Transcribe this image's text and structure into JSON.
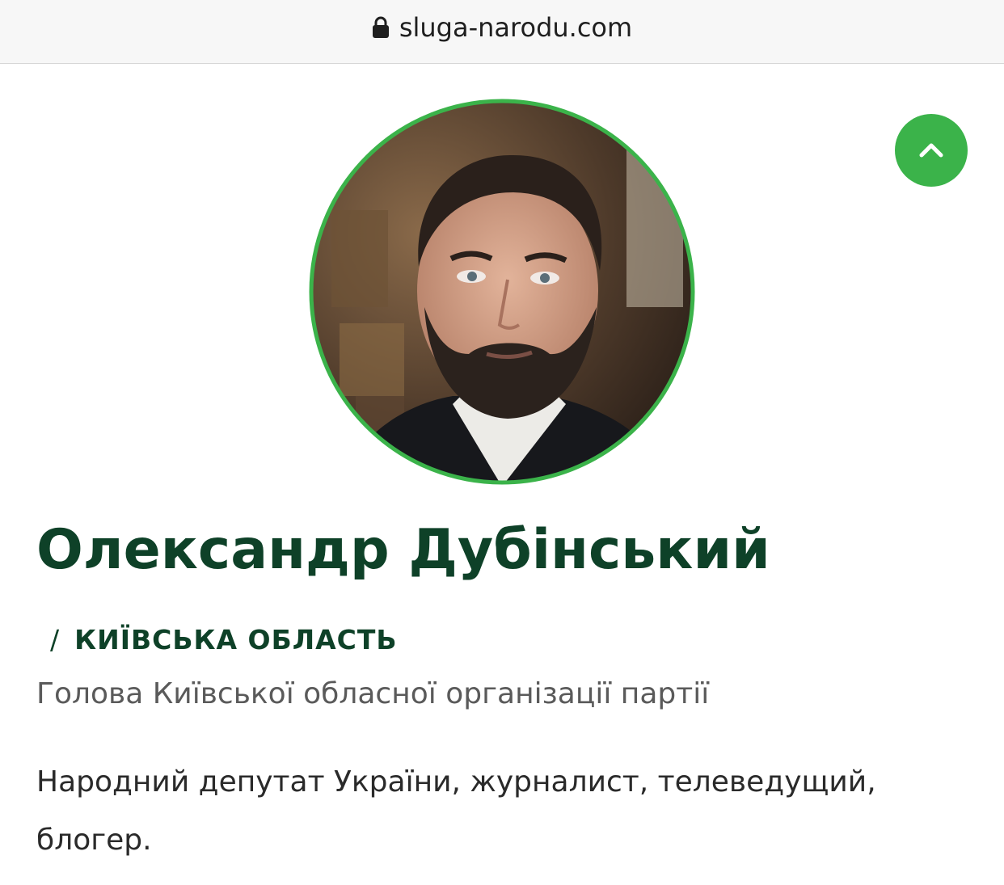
{
  "browser": {
    "url": "sluga-narodu.com",
    "lock_icon": "lock-icon"
  },
  "scroll_top": {
    "icon": "chevron-up-icon",
    "color": "#3bb34a"
  },
  "profile": {
    "photo": "portrait-photo",
    "ring_color": "#3bb34a",
    "name": "Олександр Дубінський",
    "region_separator": "/",
    "region": "КИЇВСЬКА ОБЛАСТЬ",
    "position": "Голова Київської обласної організації партії",
    "description": "Народний депутат України, журналист, телеведущий, блогер."
  },
  "colors": {
    "heading": "#0e4128",
    "accent": "#3bb34a",
    "subtitle": "#5a5a5a",
    "body_text": "#2a2a2a"
  }
}
